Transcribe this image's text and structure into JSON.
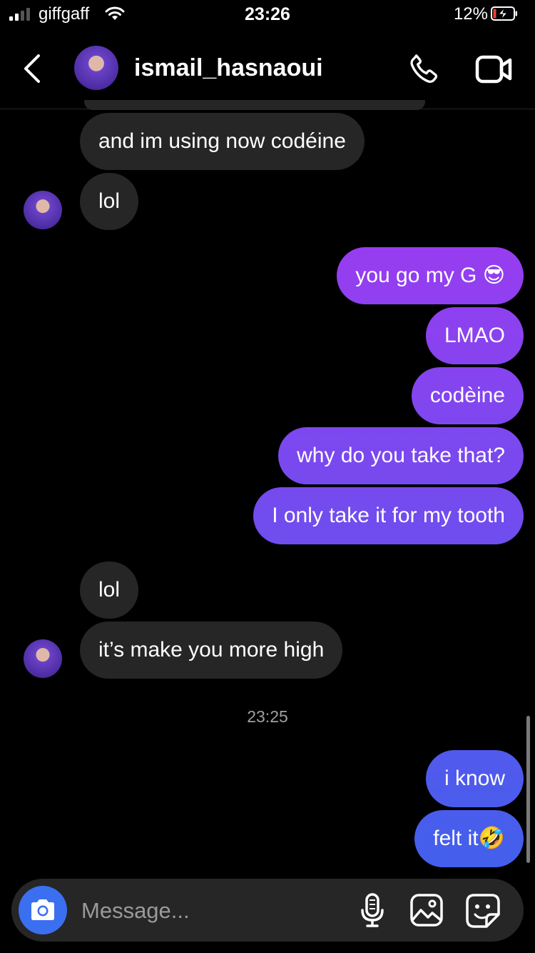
{
  "status_bar": {
    "carrier": "giffgaff",
    "time": "23:26",
    "battery_percent": "12%",
    "signal_bars": 2
  },
  "header": {
    "username": "ismail_hasnaoui",
    "icons": [
      "back-chevron-icon",
      "profile-avatar",
      "phone-icon",
      "video-camera-icon"
    ]
  },
  "messages": [
    {
      "from": "them",
      "text": "and im using now codéine"
    },
    {
      "from": "them",
      "text": "lol"
    },
    {
      "from": "me",
      "text": "you go my G 😎"
    },
    {
      "from": "me",
      "text": "LMAO"
    },
    {
      "from": "me",
      "text": "codèine"
    },
    {
      "from": "me",
      "text": "why do you take that?"
    },
    {
      "from": "me",
      "text": "I only take it for my tooth"
    },
    {
      "from": "them",
      "text": "lol"
    },
    {
      "from": "them",
      "text": "it’s make you more high"
    },
    {
      "from": "me",
      "text": "i know"
    },
    {
      "from": "me",
      "text": "felt it🤣"
    }
  ],
  "timestamp": "23:25",
  "composer": {
    "placeholder": "Message...",
    "icons": [
      "camera-icon",
      "microphone-icon",
      "gallery-icon",
      "sticker-icon"
    ]
  },
  "colors": {
    "background": "#000000",
    "incoming_bubble": "#262626",
    "outgoing_gradient_top": "#9b3bf0",
    "outgoing_gradient_bottom": "#3a63ec",
    "camera_button": "#3a6ff0",
    "battery_low": "#ff3b30"
  }
}
